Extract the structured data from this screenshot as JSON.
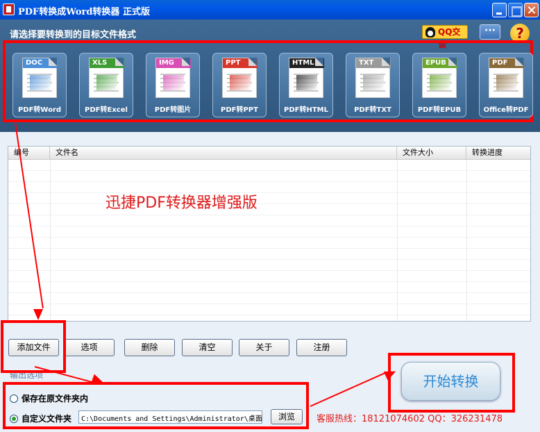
{
  "window": {
    "title": "PDF转换成Word转换器  正式版"
  },
  "header": {
    "prompt": "请选择要转换到的目标文件格式",
    "qq_label": "QQ交谈",
    "menu_label": "···",
    "help_label": "?"
  },
  "formats": [
    {
      "tag": "DOC",
      "label": "PDF转Word",
      "color": "#4a8fd8"
    },
    {
      "tag": "XLS",
      "label": "PDF转Excel",
      "color": "#3f9c35"
    },
    {
      "tag": "IMG",
      "label": "PDF转图片",
      "color": "#d94fb5"
    },
    {
      "tag": "PPT",
      "label": "PDF转PPT",
      "color": "#d9362b"
    },
    {
      "tag": "HTML",
      "label": "PDF转HTML",
      "color": "#222222"
    },
    {
      "tag": "TXT",
      "label": "PDF转TXT",
      "color": "#9a9a9a"
    },
    {
      "tag": "EPUB",
      "label": "PDF转EPUB",
      "color": "#6aa82a"
    },
    {
      "tag": "PDF",
      "label": "Office转PDF",
      "color": "#8b6a3a"
    }
  ],
  "table": {
    "columns": [
      "编号",
      "文件名",
      "文件大小",
      "转换进度"
    ],
    "rows": []
  },
  "watermark": "迅捷PDF转换器增强版",
  "toolbar": {
    "add": "添加文件",
    "options": "选项",
    "delete": "删除",
    "clear": "清空",
    "about": "关于",
    "register": "注册"
  },
  "output": {
    "label": "输出选项",
    "option_original": "保存在原文件夹内",
    "option_custom": "自定义文件夹",
    "selected": "custom",
    "path": "C:\\Documents and Settings\\Administrator\\桌面",
    "browse": "浏览"
  },
  "start_button": "开始转换",
  "hotline": "客服热线：18121074602 QQ：326231478",
  "colors": {
    "annotation": "#ff0000",
    "titlebar": "#0058e6",
    "panel": "#3b5f82"
  }
}
